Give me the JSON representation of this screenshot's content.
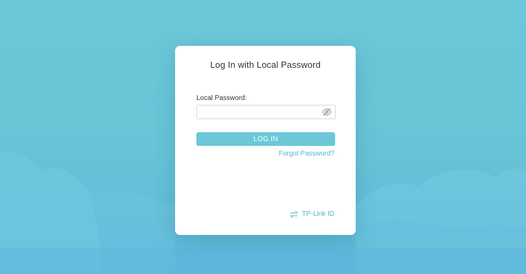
{
  "login": {
    "title": "Log In with Local Password",
    "password_label": "Local Password:",
    "password_value": "",
    "password_placeholder": "",
    "login_button": "LOG IN",
    "forgot_link": "Forgot Password?",
    "tplink_id_link": "TP-Link ID"
  },
  "icons": {
    "password_toggle": "eye-slash-icon",
    "switch_account": "swap-arrows-icon"
  },
  "colors": {
    "background": "#6cc8d8",
    "accent": "#4cb8cc",
    "button": "#6cc8d8",
    "card": "#ffffff"
  }
}
